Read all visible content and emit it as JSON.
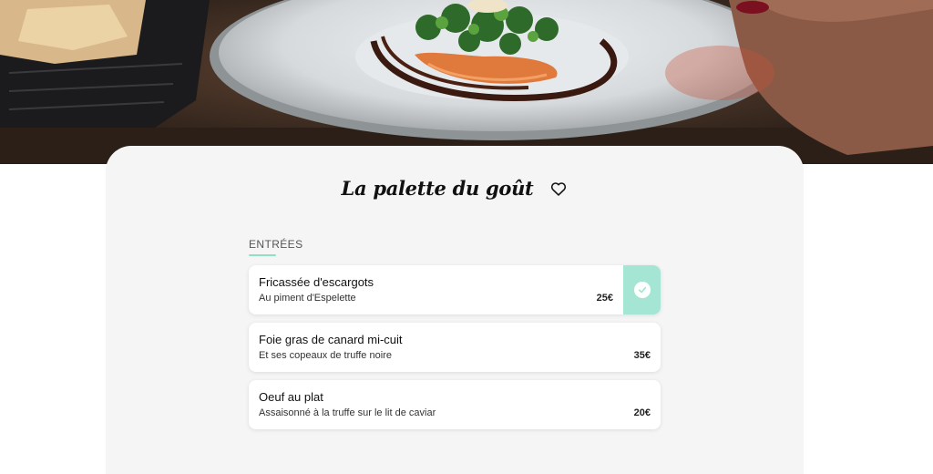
{
  "restaurant": {
    "title": "La palette du goût",
    "favorite_icon": "heart-outline-icon"
  },
  "section": {
    "label": "ENTRÉES",
    "accent_color": "#8fe0c7"
  },
  "items": [
    {
      "name": "Fricassée d'escargots",
      "description": "Au piment d'Espelette",
      "price": "25€",
      "selected": true
    },
    {
      "name": "Foie gras de canard mi-cuit",
      "description": "Et ses copeaux de truffe noire",
      "price": "35€",
      "selected": false
    },
    {
      "name": "Oeuf au plat",
      "description": "Assaisonné à la truffe sur le lit de caviar",
      "price": "20€",
      "selected": false
    }
  ],
  "colors": {
    "selected_bg": "#a4e6d3",
    "card_bg": "#f5f5f5"
  }
}
